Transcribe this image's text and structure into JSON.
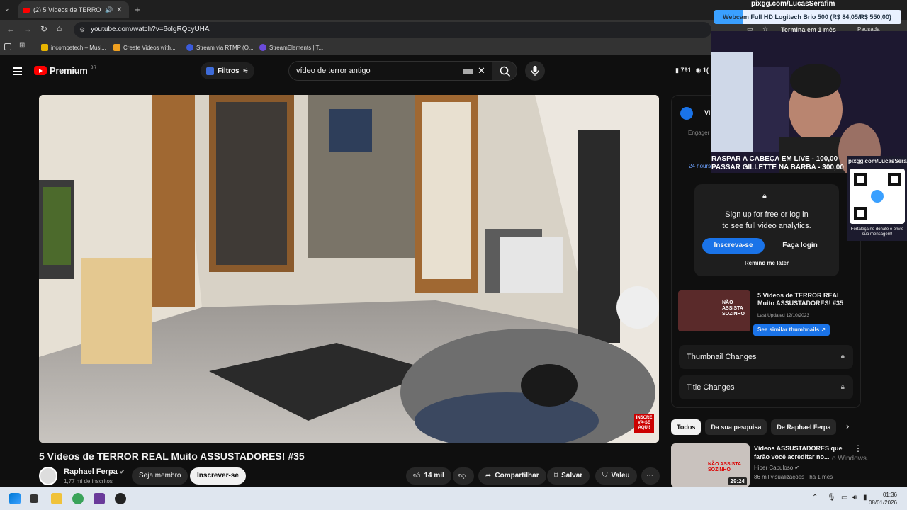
{
  "browser": {
    "tab_title": "(2) 5 Vídeos de TERROR RE...",
    "url": "youtube.com/watch?v=6olgRQcyUHA",
    "bookmarks": [
      {
        "label": "incompetech – Musi...",
        "color": "#e8b400"
      },
      {
        "label": "Create Videos with...",
        "color": "#f0a020"
      },
      {
        "label": "Stream via RTMP (O...",
        "color": "#3b5bdb"
      },
      {
        "label": "StreamElements | T...",
        "color": "#6b4bdb"
      }
    ]
  },
  "header": {
    "logo": "Premium",
    "region": "BR",
    "filters_label": "Filtros",
    "search_value": "vídeo de terror antigo",
    "count_a": "791",
    "count_b": "1("
  },
  "video": {
    "title": "5 Vídeos de TERROR REAL Muito ASSUSTADORES! #35",
    "badge": "INSCRE VA-SE AQUI!",
    "channel_name": "Raphael Ferpa",
    "subscribers": "1,77 mi de inscritos",
    "member_label": "Seja membro",
    "subscribe_label": "Inscrever-se",
    "likes": "14 mil",
    "share_label": "Compartilhar",
    "save_label": "Salvar",
    "valeu_label": "Valeu"
  },
  "analytics": {
    "tab_label": "Vi",
    "engagement_label": "Engager",
    "hours_label": "24 hours",
    "signup_line1": "Sign up for free or log in",
    "signup_line2": "to see full video analytics.",
    "subscribe_btn": "Inscreva-se",
    "login_btn": "Faça login",
    "remind_label": "Remind me later",
    "card_title": "5 Vídeos de TERROR REAL Muito ASSUSTADORES! #35",
    "card_updated": "Last Updated 12/10/2023",
    "card_button": "See similar thumbnails",
    "thumb_text": "NÃO ASSISTA SOZINHO",
    "rows": [
      "Thumbnail Changes",
      "Title Changes"
    ]
  },
  "chips": [
    "Todos",
    "Da sua pesquisa",
    "De Raphael Ferpa"
  ],
  "recommended": {
    "title": "Vídeos ASSUSTADORES que farão você acreditar no...",
    "channel": "Hiper Cabuloso",
    "meta": "86 mil visualizações · há 1 mês",
    "duration": "29:24",
    "thumb_text": "NÃO ASSISTA SOZINHO"
  },
  "overlay": {
    "channel_url": "pixgg.com/LucasSerafim",
    "banner": "Webcam Full HD Logitech Brio 500 (R$ 84,05/R$ 550,00)",
    "status_text": "Termina em 1 mês",
    "paused_label": "Pausada",
    "goal_line1": "RASPAR A CABEÇA EM LIVE - 100,00",
    "goal_line2": "PASSAR GILLETTE NA BARBA - 300,00",
    "qr_url": "pixgg.com/LucasSerafim",
    "qr_caption": "Fortaleça no donate e envie sua mensagem!",
    "windows_watermark": "o Windows."
  },
  "taskbar": {
    "time": "01:36",
    "date": "08/01/2026"
  }
}
